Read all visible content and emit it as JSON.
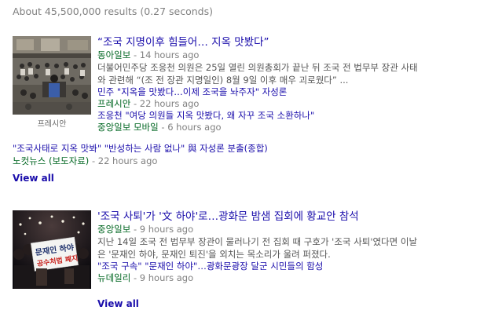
{
  "results_stats": "About 45,500,000 results (0.27 seconds)",
  "cards": [
    {
      "thumbnail_caption": "프레시안",
      "headline": "“조국 지명이후 힘들어… 지옥 맛봤다”",
      "source": "동아일보",
      "time": "14 hours ago",
      "snippet_line1": "더불어민주당 조응천 의원은 25일 열린 의원총회가 끝난 뒤 조국 전 법무부 장관 사태",
      "snippet_line2": "와 관련해 “(조 전 장관 지명일인) 8월 9일 이후 매우 괴로웠다” ...",
      "related": [
        {
          "title": "민주 \"지옥을 맛봤다…이제 조국을 놔주자\" 자성론",
          "source": "프레시안",
          "time": "22 hours ago"
        },
        {
          "title": "조응천 \"여당 의원들 지옥 맛봤다, 왜 자꾸 조국 소환하나\"",
          "source": "중앙일보 모바일",
          "time": "6 hours ago"
        },
        {
          "title": "\"조국사태로 지옥 맛봐\" \"반성하는 사람 없나\" 與 자성론 분출(종합)",
          "source": "노컷뉴스 (보도자료)",
          "time": "22 hours ago"
        }
      ],
      "view_all": "View all"
    },
    {
      "thumbnail_caption": "",
      "headline": "'조국 사퇴'가 '文 하야'로…광화문 밤샘 집회에 황교안 참석",
      "source": "중앙일보",
      "time": "9 hours ago",
      "snippet_line1": "지난 14일 조국 전 법무부 장관이 물러나기 전 집회 때 구호가 '조국 사퇴'였다면 이날",
      "snippet_line2": "은 '문재인 하야, 문재인 퇴진'을 외치는 목소리가 울려 퍼졌다.",
      "related": [
        {
          "title": "\"조국 구속\" \"문재인 하야\"…광화문광장 달군 시민들의 함성",
          "source": "뉴데일리",
          "time": "9 hours ago"
        }
      ],
      "view_all": "View all"
    }
  ],
  "sign_text": {
    "line1": "문재인 하야",
    "line2": "공수처법 폐지"
  },
  "separator": "-",
  "colors": {
    "link": "#1a0dab",
    "source": "#006621",
    "snippet": "#545454",
    "muted": "#808080"
  }
}
